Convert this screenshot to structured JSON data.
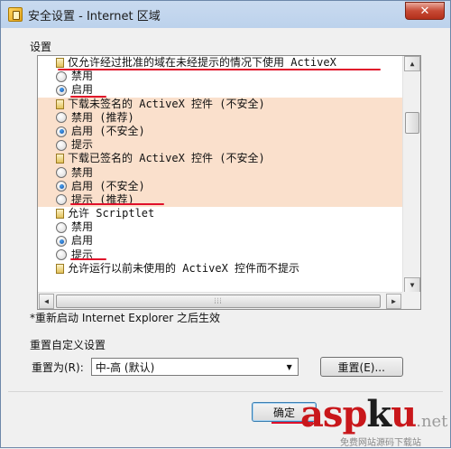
{
  "window": {
    "title": "安全设置 - Internet 区域",
    "close_glyph": "✕"
  },
  "settings": {
    "group_label": "设置",
    "items": [
      {
        "label": "仅允许经过批准的域在未经提示的情况下使用 ActiveX",
        "options": [
          {
            "label": "禁用",
            "checked": false
          },
          {
            "label": "启用",
            "checked": true
          }
        ]
      },
      {
        "label": "下载未签名的 ActiveX 控件 (不安全)",
        "options": [
          {
            "label": "禁用 (推荐)",
            "checked": false
          },
          {
            "label": "启用 (不安全)",
            "checked": true
          },
          {
            "label": "提示",
            "checked": false
          }
        ]
      },
      {
        "label": "下载已签名的 ActiveX 控件 (不安全)",
        "options": [
          {
            "label": "禁用",
            "checked": false
          },
          {
            "label": "启用 (不安全)",
            "checked": true
          },
          {
            "label": "提示 (推荐)",
            "checked": false
          }
        ]
      },
      {
        "label": "允许 Scriptlet",
        "options": [
          {
            "label": "禁用",
            "checked": false
          },
          {
            "label": "启用",
            "checked": true
          },
          {
            "label": "提示",
            "checked": false
          }
        ]
      },
      {
        "label": "允许运行以前未使用的 ActiveX 控件而不提示",
        "options": []
      }
    ],
    "restart_note": "*重新启动 Internet Explorer 之后生效"
  },
  "reset": {
    "group_label": "重置自定义设置",
    "reset_to_label": "重置为(R):",
    "level_value": "中-高 (默认)",
    "reset_button": "重置(E)..."
  },
  "footer": {
    "ok_button": "确定"
  },
  "watermark": {
    "logo_a": "asp",
    "logo_b": "k",
    "logo_c": "u",
    "logo_d": ".net",
    "subtitle": "免费网站源码下载站"
  },
  "colors": {
    "highlight_shade": "#fae0cc",
    "annotation_red": "#e0102a"
  }
}
